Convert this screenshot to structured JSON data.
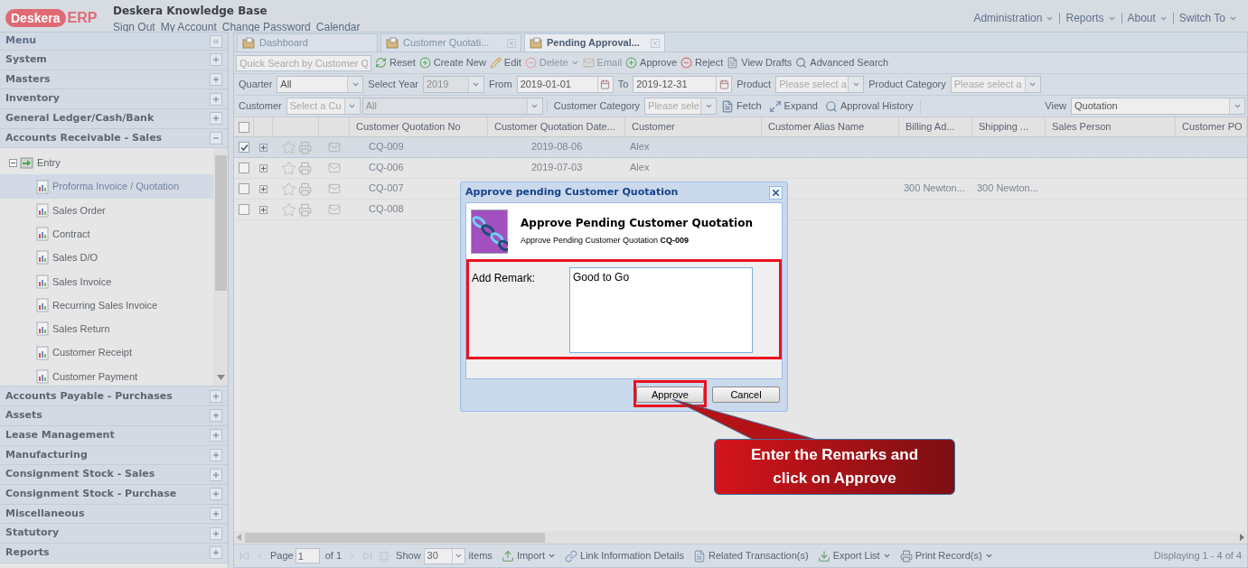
{
  "header": {
    "logo_name": "Deskera",
    "logo_product": "ERP",
    "title": "Deskera Knowledge Base",
    "links": [
      "Sign Out",
      "My Account",
      "Change Password",
      "Calendar"
    ],
    "menus": [
      "Administration",
      "Reports",
      "About",
      "Switch To"
    ]
  },
  "sidebar": {
    "title": "Menu",
    "sections": [
      {
        "label": "System",
        "expanded": false
      },
      {
        "label": "Masters",
        "expanded": false
      },
      {
        "label": "Inventory",
        "expanded": false
      },
      {
        "label": "General Ledger/Cash/Bank",
        "expanded": false
      },
      {
        "label": "Accounts Receivable - Sales",
        "expanded": true,
        "children": [
          {
            "label": "Entry",
            "expanded": true,
            "children": [
              {
                "label": "Proforma Invoice / Quotation",
                "selected": true
              },
              {
                "label": "Sales Order",
                "selected": false
              },
              {
                "label": "Contract",
                "selected": false
              },
              {
                "label": "Sales D/O",
                "selected": false
              },
              {
                "label": "Sales Invoice",
                "selected": false
              },
              {
                "label": "Recurring Sales Invoice",
                "selected": false
              },
              {
                "label": "Sales Return",
                "selected": false
              },
              {
                "label": "Customer Receipt",
                "selected": false
              },
              {
                "label": "Customer Payment",
                "selected": false
              }
            ]
          }
        ]
      },
      {
        "label": "Accounts Payable - Purchases",
        "expanded": false
      },
      {
        "label": "Assets",
        "expanded": false
      },
      {
        "label": "Lease Management",
        "expanded": false
      },
      {
        "label": "Manufacturing",
        "expanded": false
      },
      {
        "label": "Consignment Stock - Sales",
        "expanded": false
      },
      {
        "label": "Consignment Stock - Purchase",
        "expanded": false
      },
      {
        "label": "Miscellaneous",
        "expanded": false
      },
      {
        "label": "Statutory",
        "expanded": false
      },
      {
        "label": "Reports",
        "expanded": false
      }
    ]
  },
  "tabs": [
    {
      "label": "Dashboard",
      "selected": false,
      "closable": false
    },
    {
      "label": "Customer Quotati...",
      "selected": false,
      "closable": true
    },
    {
      "label": "Pending Approval...",
      "selected": true,
      "closable": true
    }
  ],
  "toolbar": {
    "search_placeholder": "Quick Search by Customer Q",
    "buttons": [
      {
        "label": "Reset",
        "disabled": false,
        "menu": false
      },
      {
        "label": "Create New",
        "disabled": false,
        "menu": false
      },
      {
        "label": "Edit",
        "disabled": false,
        "menu": false
      },
      {
        "label": "Delete",
        "disabled": true,
        "menu": true
      },
      {
        "label": "Email",
        "disabled": true,
        "menu": false
      },
      {
        "label": "Approve",
        "disabled": false,
        "menu": false
      },
      {
        "label": "Reject",
        "disabled": false,
        "menu": false
      },
      {
        "label": "View Drafts",
        "disabled": false,
        "menu": false
      },
      {
        "label": "Advanced Search",
        "disabled": false,
        "menu": false
      }
    ]
  },
  "filters": [
    {
      "left": [
        {
          "kind": "label",
          "text": "Quarter"
        },
        {
          "kind": "combo",
          "value": "All",
          "disabled": false
        },
        {
          "kind": "label",
          "text": "Select Year"
        },
        {
          "kind": "combo",
          "value": "2019",
          "disabled": true
        },
        {
          "kind": "label",
          "text": "From"
        },
        {
          "kind": "date",
          "value": "2019-01-01"
        },
        {
          "kind": "label",
          "text": "To"
        },
        {
          "kind": "date",
          "value": "2019-12-31"
        },
        {
          "kind": "label",
          "text": "Product"
        },
        {
          "kind": "combo",
          "placeholder": "Please select a"
        },
        {
          "kind": "label",
          "text": "Product Category"
        },
        {
          "kind": "combo",
          "placeholder": "Please select a"
        }
      ]
    },
    {
      "left": [
        {
          "kind": "label",
          "text": "Customer"
        },
        {
          "kind": "combo",
          "placeholder": "Select a Cu"
        },
        {
          "kind": "combo",
          "value": "All",
          "disabled": true
        },
        {
          "kind": "label",
          "text": "Customer Category"
        },
        {
          "kind": "combo",
          "placeholder": "Please sele"
        },
        {
          "kind": "button",
          "text": "Fetch"
        },
        {
          "kind": "button",
          "text": "Expand"
        },
        {
          "kind": "button",
          "text": "Approval History"
        }
      ],
      "right": [
        {
          "kind": "label",
          "text": "View"
        },
        {
          "kind": "combo",
          "value": "Quotation",
          "disabled": false
        }
      ]
    }
  ],
  "grid": {
    "all_checked": false,
    "columns": [
      "Customer Quotation No",
      "Customer Quotation Date...",
      "Customer",
      "Customer Alias Name",
      "Billing Ad...",
      "Shipping ...",
      "Sales Person",
      "Customer PO"
    ],
    "rows": [
      {
        "checked": true,
        "cells": [
          "CQ-009",
          "2019-08-06",
          "Alex",
          "",
          "",
          "",
          "",
          ""
        ]
      },
      {
        "checked": false,
        "cells": [
          "CQ-006",
          "2019-07-03",
          "Alex",
          "",
          "",
          "",
          "",
          ""
        ]
      },
      {
        "checked": false,
        "cells": [
          "CQ-007",
          "",
          "",
          "",
          "300 Newton...",
          "300 Newton...",
          "",
          ""
        ]
      },
      {
        "checked": false,
        "cells": [
          "CQ-008",
          "",
          "",
          "",
          "",
          "",
          "",
          ""
        ]
      }
    ]
  },
  "paging": {
    "page_label": "Page",
    "page": "1",
    "of": "of 1",
    "show_label": "Show",
    "show": "30",
    "items_label": "items",
    "buttons": [
      {
        "label": "Import",
        "menu": true
      },
      {
        "label": "Link Information Details",
        "menu": false
      },
      {
        "label": "Related Transaction(s)",
        "menu": false
      },
      {
        "label": "Export List",
        "menu": true
      },
      {
        "label": "Print Record(s)",
        "menu": true
      }
    ],
    "status": "Displaying 1 - 4 of 4"
  },
  "dialog": {
    "title": "Approve pending Customer Quotation",
    "heading": "Approve Pending Customer Quotation",
    "subtitle": "Approve Pending Customer Quotation **CQ-009**",
    "remark_label": "Add Remark:",
    "remark": "Good to Go",
    "buttons": [
      {
        "label": "Approve",
        "highlighted": true
      },
      {
        "label": "Cancel",
        "highlighted": false
      }
    ]
  },
  "callout": {
    "text": "Enter the Remarks and click on Approve"
  }
}
